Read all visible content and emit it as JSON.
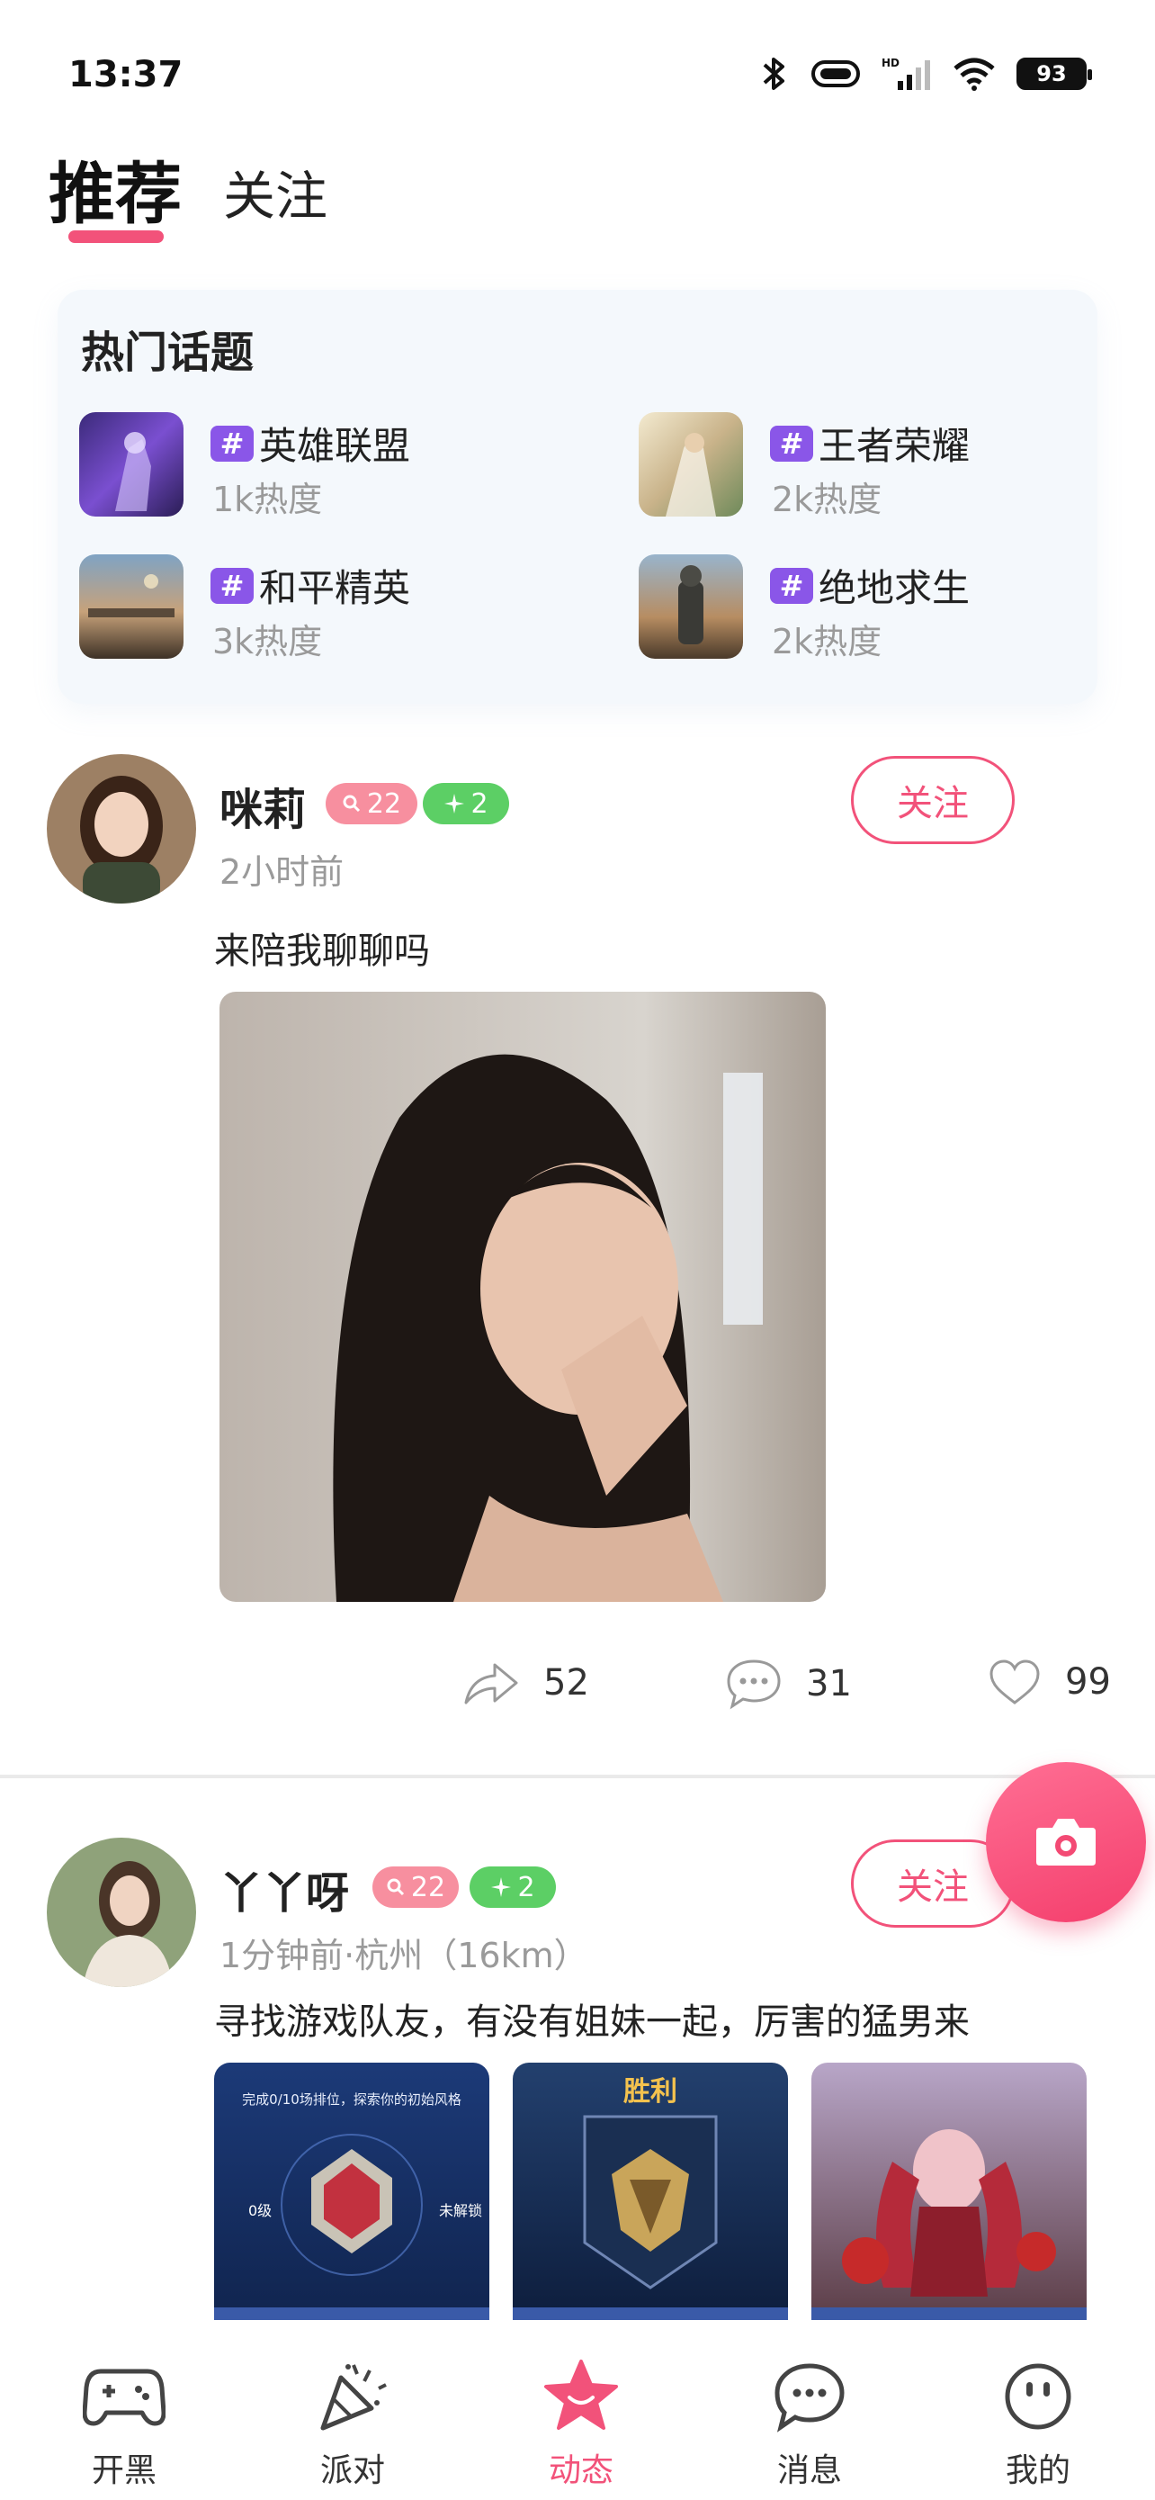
{
  "status_bar": {
    "time": "13:37",
    "battery": "93"
  },
  "tabs": [
    {
      "label": "推荐",
      "active": true
    },
    {
      "label": "关注",
      "active": false
    }
  ],
  "hot_topics": {
    "title": "热门话题",
    "items": [
      {
        "name": "英雄联盟",
        "heat": "1k热度"
      },
      {
        "name": "王者荣耀",
        "heat": "2k热度"
      },
      {
        "name": "和平精英",
        "heat": "3k热度"
      },
      {
        "name": "绝地求生",
        "heat": "2k热度"
      }
    ]
  },
  "posts": [
    {
      "username": "咪莉",
      "badge_pink": "22",
      "badge_green": "2",
      "meta": "2小时前",
      "follow_label": "关注",
      "text": "来陪我聊聊吗",
      "shares": "52",
      "comments": "31",
      "likes": "99"
    },
    {
      "username": "丫丫呀",
      "badge_pink": "22",
      "badge_green": "2",
      "meta": "1分钟前·杭州（16km）",
      "follow_label": "关注",
      "text": "寻找游戏队友，有没有姐妹一起，厉害的猛男来",
      "tile_texts": {
        "t1_caption": "完成0/10场排位，探索你的初始风格",
        "t1_left": "0级",
        "t1_right": "未解锁",
        "t2_title": "胜利"
      }
    }
  ],
  "bottom_nav": [
    {
      "label": "开黑",
      "icon": "gamepad-icon"
    },
    {
      "label": "派对",
      "icon": "party-popper-icon"
    },
    {
      "label": "动态",
      "icon": "star-icon",
      "active": true
    },
    {
      "label": "消息",
      "icon": "chat-bubble-icon"
    },
    {
      "label": "我的",
      "icon": "face-icon"
    }
  ],
  "colors": {
    "accent": "#f2527a",
    "topic_hash": "#8a56e8",
    "badge_green": "#5ccf65",
    "badge_pink": "#f78f9f"
  }
}
